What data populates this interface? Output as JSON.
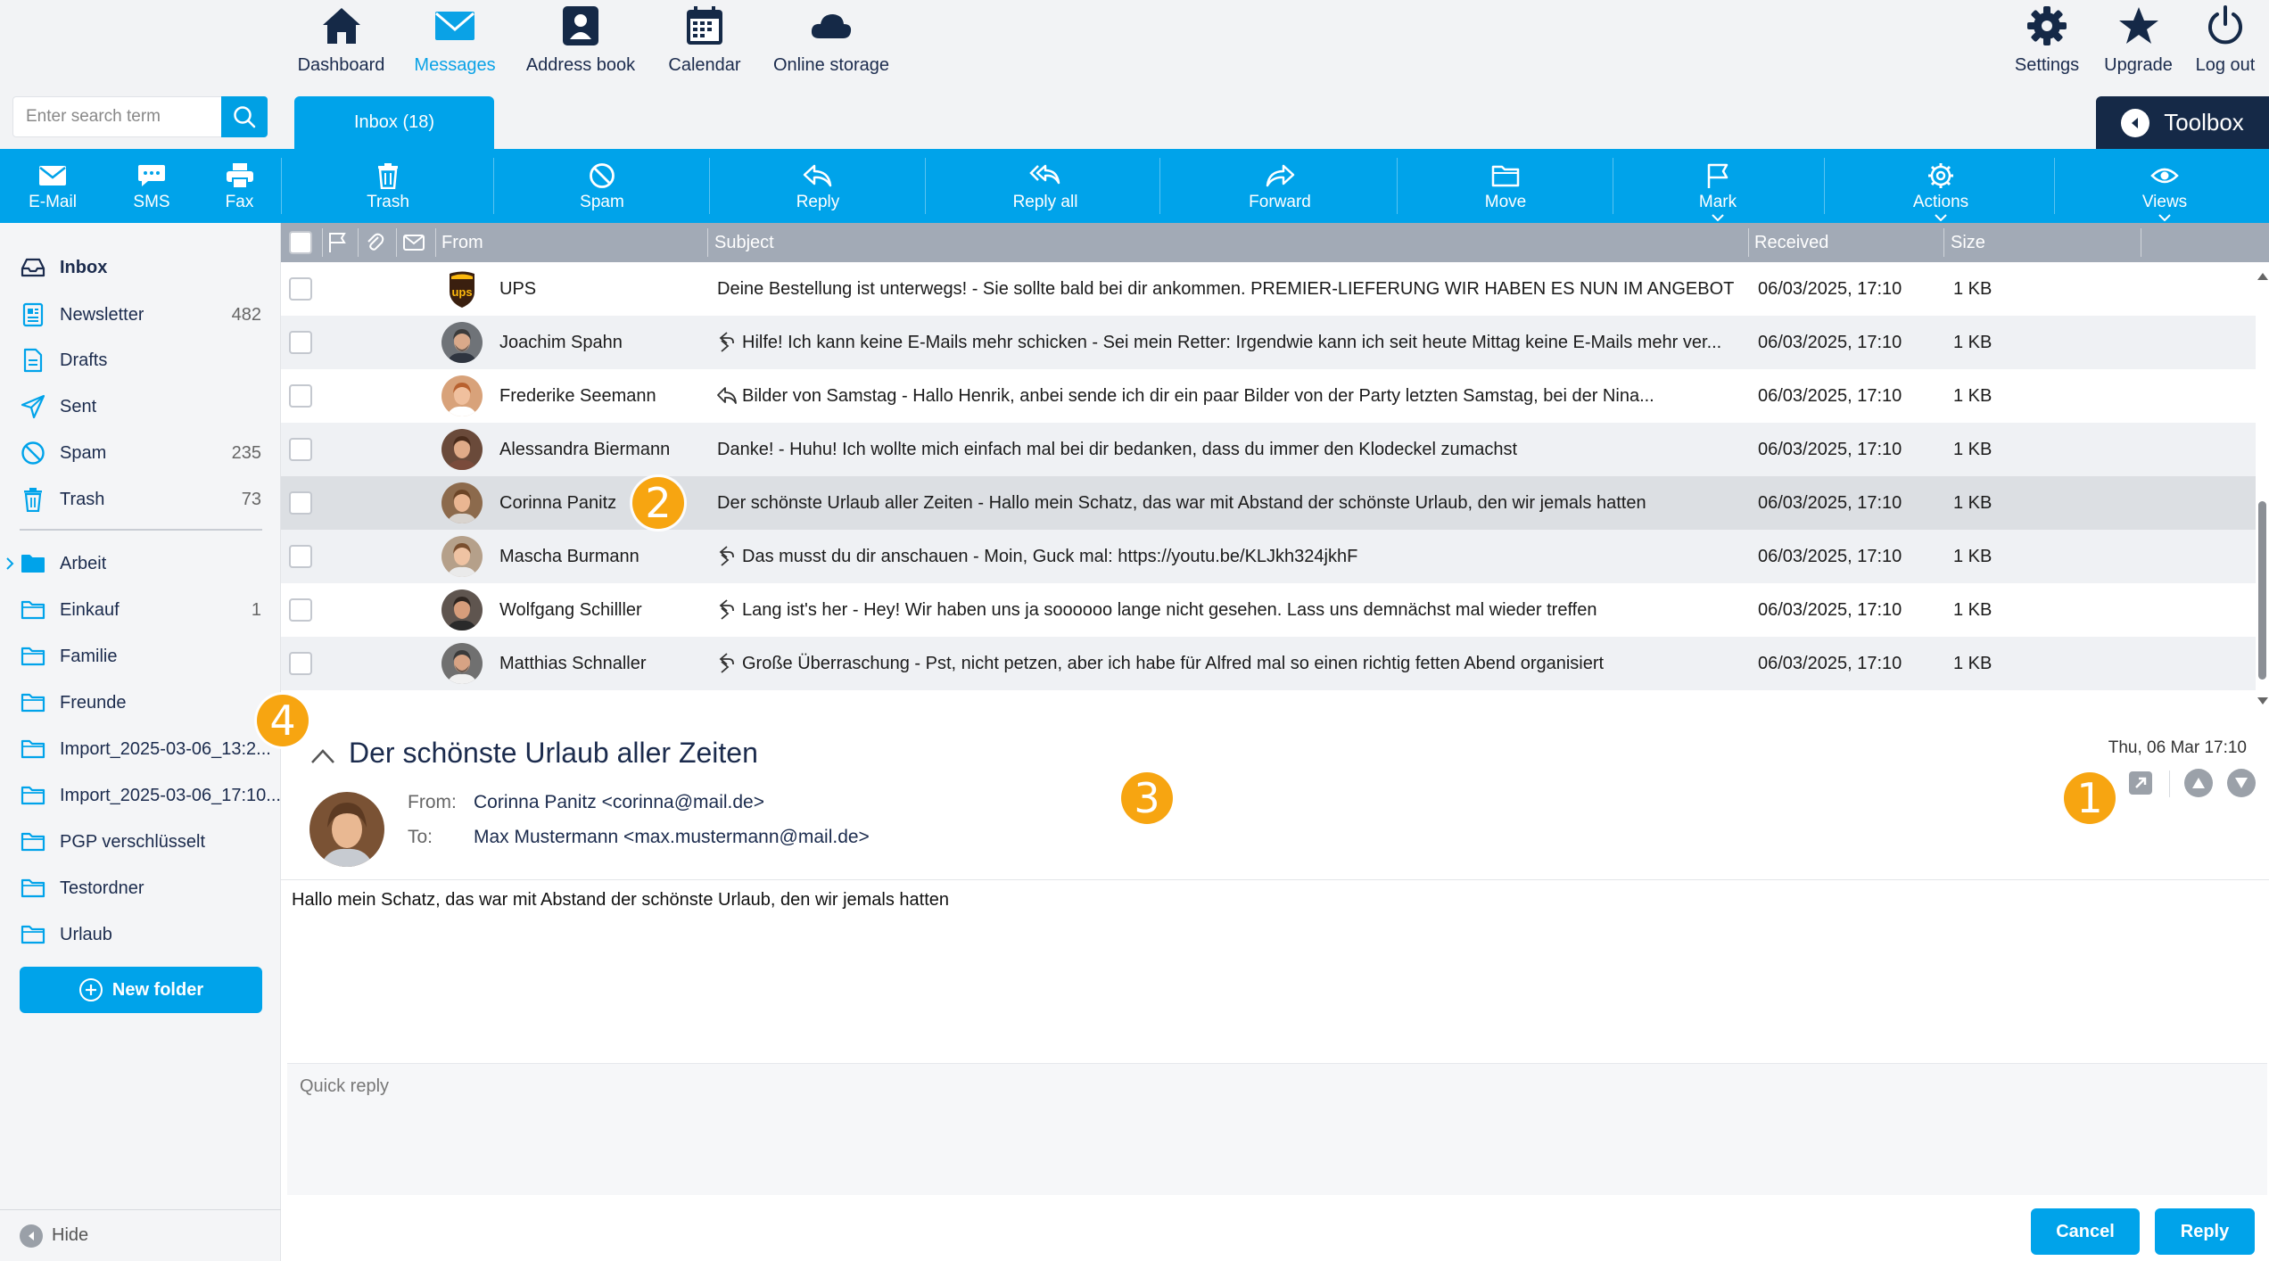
{
  "topnav": {
    "items": [
      {
        "label": "Dashboard",
        "icon": "home-icon"
      },
      {
        "label": "Messages",
        "icon": "envelope-icon"
      },
      {
        "label": "Address book",
        "icon": "contact-icon"
      },
      {
        "label": "Calendar",
        "icon": "calendar-icon"
      },
      {
        "label": "Online storage",
        "icon": "cloud-icon"
      }
    ],
    "right_items": [
      {
        "label": "Settings",
        "icon": "gear-icon"
      },
      {
        "label": "Upgrade",
        "icon": "star-icon"
      },
      {
        "label": "Log out",
        "icon": "power-icon"
      }
    ],
    "active": "Messages"
  },
  "search": {
    "placeholder": "Enter search term"
  },
  "inbox_tab": {
    "label": "Inbox (18)"
  },
  "toolbox": {
    "label": "Toolbox"
  },
  "compose": [
    {
      "label": "E-Mail",
      "icon": "envelope-icon"
    },
    {
      "label": "SMS",
      "icon": "sms-icon"
    },
    {
      "label": "Fax",
      "icon": "printer-icon"
    }
  ],
  "actions": [
    {
      "label": "Trash",
      "icon": "trash-icon"
    },
    {
      "label": "Spam",
      "icon": "spam-icon"
    },
    {
      "label": "Reply",
      "icon": "reply-icon"
    },
    {
      "label": "Reply all",
      "icon": "reply-all-icon"
    },
    {
      "label": "Forward",
      "icon": "forward-icon"
    },
    {
      "label": "Move",
      "icon": "folder-icon"
    },
    {
      "label": "Mark",
      "icon": "flag-icon"
    },
    {
      "label": "Actions",
      "icon": "gear-icon"
    },
    {
      "label": "Views",
      "icon": "eye-icon"
    }
  ],
  "folders": [
    {
      "name": "Inbox",
      "count": "",
      "icon": "inbox-icon"
    },
    {
      "name": "Newsletter",
      "count": "482",
      "icon": "newsletter-icon"
    },
    {
      "name": "Drafts",
      "count": "",
      "icon": "draft-icon"
    },
    {
      "name": "Sent",
      "count": "",
      "icon": "sent-icon"
    },
    {
      "name": "Spam",
      "count": "235",
      "icon": "spam-icon"
    },
    {
      "name": "Trash",
      "count": "73",
      "icon": "trash-icon"
    },
    {
      "name": "Arbeit",
      "count": "",
      "icon": "folder-icon"
    },
    {
      "name": "Einkauf",
      "count": "1",
      "icon": "folder-icon"
    },
    {
      "name": "Familie",
      "count": "",
      "icon": "folder-icon"
    },
    {
      "name": "Freunde",
      "count": "",
      "icon": "folder-icon"
    },
    {
      "name": "Import_2025-03-06_13:2...",
      "count": "",
      "icon": "folder-icon"
    },
    {
      "name": "Import_2025-03-06_17:10...",
      "count": "",
      "icon": "folder-icon"
    },
    {
      "name": "PGP verschlüsselt",
      "count": "",
      "icon": "folder-icon"
    },
    {
      "name": "Testordner",
      "count": "",
      "icon": "folder-icon"
    },
    {
      "name": "Urlaub",
      "count": "",
      "icon": "folder-icon"
    }
  ],
  "new_folder": {
    "label": "New folder"
  },
  "hide": {
    "label": "Hide"
  },
  "list_header": {
    "from": "From",
    "subject": "Subject",
    "received": "Received",
    "size": "Size"
  },
  "messages": [
    {
      "from": "UPS",
      "subject": "Deine Bestellung ist unterwegs! - Sie sollte bald bei dir ankommen. PREMIER-LIEFERUNG WIR HABEN ES NUN IM ANGEBOT",
      "received": "06/03/2025, 17:10",
      "size": "1 KB",
      "status": "",
      "avatar": "ups"
    },
    {
      "from": "Joachim Spahn",
      "subject": "Hilfe! Ich kann keine E-Mails mehr schicken - Sei mein Retter: Irgendwie kann ich seit heute Mittag keine E-Mails mehr ver...",
      "received": "06/03/2025, 17:10",
      "size": "1 KB",
      "status": "forwarded",
      "avatar": "m1"
    },
    {
      "from": "Frederike Seemann",
      "subject": "Bilder von Samstag - Hallo Henrik, anbei sende ich dir ein paar Bilder von der Party letzten Samstag, bei der Nina...",
      "received": "06/03/2025, 17:10",
      "size": "1 KB",
      "status": "replied",
      "avatar": "f1"
    },
    {
      "from": "Alessandra Biermann",
      "subject": "Danke! - Huhu! Ich wollte mich einfach mal bei dir bedanken, dass du immer den Klodeckel zumachst",
      "received": "06/03/2025, 17:10",
      "size": "1 KB",
      "status": "",
      "avatar": "f2"
    },
    {
      "from": "Corinna Panitz",
      "subject": "Der schönste Urlaub aller Zeiten - Hallo mein Schatz, das war mit Abstand der schönste Urlaub, den wir jemals hatten",
      "received": "06/03/2025, 17:10",
      "size": "1 KB",
      "status": "",
      "avatar": "f3"
    },
    {
      "from": "Mascha Burmann",
      "subject": "Das musst du dir anschauen - Moin, Guck mal: https://youtu.be/KLJkh324jkhF",
      "received": "06/03/2025, 17:10",
      "size": "1 KB",
      "status": "forwarded",
      "avatar": "f4"
    },
    {
      "from": "Wolfgang Schilller",
      "subject": "Lang ist's her - Hey! Wir haben uns ja soooooo lange nicht gesehen. Lass uns demnächst mal wieder treffen",
      "received": "06/03/2025, 17:10",
      "size": "1 KB",
      "status": "forwarded",
      "avatar": "m2"
    },
    {
      "from": "Matthias Schnaller",
      "subject": "Große Überraschung - Pst, nicht petzen, aber ich habe für Alfred mal so einen richtig fetten Abend organisiert",
      "received": "06/03/2025, 17:10",
      "size": "1 KB",
      "status": "forwarded",
      "avatar": "m3"
    }
  ],
  "reader": {
    "subject": "Der schönste Urlaub aller Zeiten",
    "date": "Thu, 06 Mar 17:10",
    "from_label": "From:",
    "from": "Corinna Panitz <corinna@mail.de>",
    "to_label": "To:",
    "to": "Max Mustermann <max.mustermann@mail.de>",
    "body": "Hallo mein Schatz, das war mit Abstand der schönste Urlaub, den wir jemals hatten"
  },
  "quick_reply": {
    "placeholder": "Quick reply"
  },
  "buttons": {
    "cancel": "Cancel",
    "reply": "Reply"
  },
  "markers": [
    "1",
    "2",
    "3",
    "4"
  ],
  "colors": {
    "accent": "#00a3ea",
    "navy": "#152947",
    "marker": "#f7a511"
  }
}
